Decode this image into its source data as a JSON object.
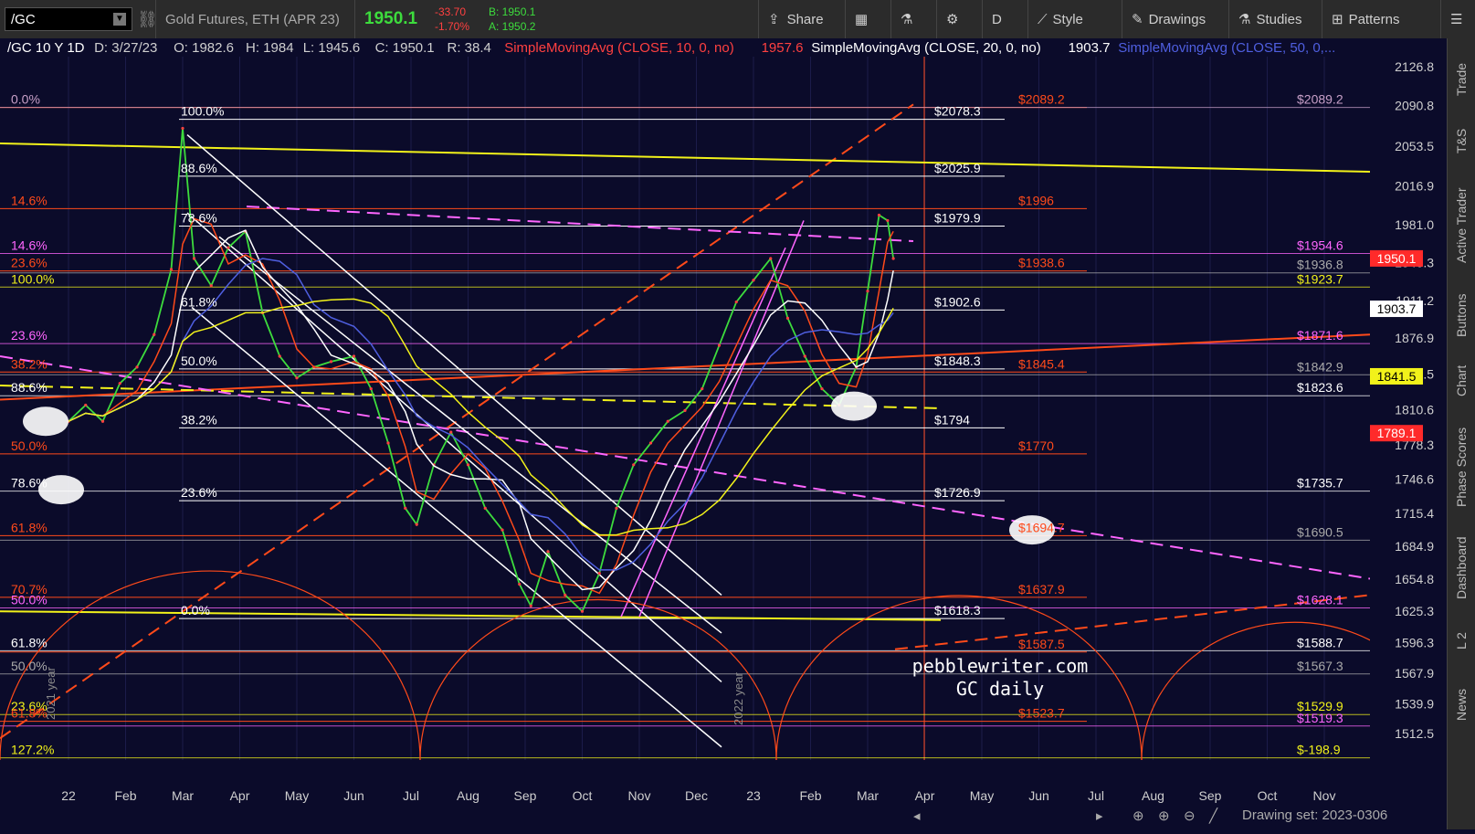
{
  "toolbar": {
    "symbol": "/GC",
    "description": "Gold Futures, ETH (APR 23)",
    "last": "1950.1",
    "change": "-33.70",
    "change_pct": "-1.70%",
    "bid": "B: 1950.1",
    "ask": "A: 1950.2",
    "share": "Share",
    "period": "D",
    "style": "Style",
    "drawings": "Drawings",
    "studies": "Studies",
    "patterns": "Patterns"
  },
  "header": {
    "symbol_period": "/GC 10 Y 1D",
    "date": "D: 3/27/23",
    "open": "O: 1982.6",
    "high": "H: 1984",
    "low": "L: 1945.6",
    "close": "C: 1950.1",
    "range": "R: 38.4",
    "sma10": "SimpleMovingAvg (CLOSE, 10, 0, no)",
    "sma10_val": "1957.6",
    "sma20": "SimpleMovingAvg (CLOSE, 20, 0, no)",
    "sma20_val": "1903.7",
    "sma50": "SimpleMovingAvg (CLOSE, 50, 0,..."
  },
  "right_tabs": [
    "Trade",
    "T&S",
    "Active Trader",
    "Buttons",
    "Chart",
    "Phase Scores",
    "Dashboard",
    "L 2",
    "News"
  ],
  "bottom": {
    "drawing_set": "Drawing set: 2023-0306"
  },
  "watermark": {
    "line1": "pebblewriter.com",
    "line2": "GC daily"
  },
  "colors": {
    "bg": "#0b0b2a",
    "orange": "#ff4a1a",
    "yellow": "#f2f21a",
    "pink": "#ff66ff",
    "white": "#ffffff",
    "blue": "#4f5fe0"
  },
  "chart_data": {
    "type": "line",
    "x_labels": [
      "22",
      "Feb",
      "Mar",
      "Apr",
      "May",
      "Jun",
      "Jul",
      "Aug",
      "Sep",
      "Oct",
      "Nov",
      "Dec",
      "23",
      "Feb",
      "Mar",
      "Apr",
      "May",
      "Jun",
      "Jul",
      "Aug",
      "Sep",
      "Oct",
      "Nov"
    ],
    "y_ticks": [
      2126.8,
      2090.8,
      2053.5,
      2016.9,
      1981,
      1946.3,
      1911.2,
      1876.9,
      1843.5,
      1810.6,
      1778.3,
      1746.6,
      1715.4,
      1684.9,
      1654.8,
      1625.3,
      1596.3,
      1567.9,
      1539.9,
      1512.5
    ],
    "ylim": [
      1488,
      2136
    ],
    "price_tags": [
      {
        "label": "1950.1",
        "value": 1950.1,
        "color": "#ff2a2a"
      },
      {
        "label": "1903.7",
        "value": 1903.7,
        "color": "#ffffff"
      },
      {
        "label": "1841.5",
        "value": 1841.5,
        "color": "#f2f21a"
      },
      {
        "label": "1789.1",
        "value": 1789.1,
        "color": "#ff2a2a"
      }
    ],
    "fib_left": [
      {
        "label": "100.0%",
        "value": 2078.3
      },
      {
        "label": "88.6%",
        "value": 2025.9
      },
      {
        "label": "78.6%",
        "value": 1979.9
      },
      {
        "label": "61.8%",
        "value": 1902.6
      },
      {
        "label": "50.0%",
        "value": 1848.3
      },
      {
        "label": "38.2%",
        "value": 1794
      },
      {
        "label": "23.6%",
        "value": 1726.9
      },
      {
        "label": "0.0%",
        "value": 1618.3
      }
    ],
    "fib_right_white": [
      {
        "label": "$2078.3",
        "value": 2078.3
      },
      {
        "label": "$2025.9",
        "value": 2025.9
      },
      {
        "label": "$1979.9",
        "value": 1979.9
      },
      {
        "label": "$1902.6",
        "value": 1902.6
      },
      {
        "label": "$1848.3",
        "value": 1848.3
      },
      {
        "label": "$1794",
        "value": 1794
      },
      {
        "label": "$1726.9",
        "value": 1726.9
      },
      {
        "label": "$1618.3",
        "value": 1618.3
      }
    ],
    "levels_orange": [
      {
        "label": "$2089.2",
        "value": 2089.2
      },
      {
        "label": "$1996",
        "value": 1996
      },
      {
        "label": "$1938.6",
        "value": 1938.6
      },
      {
        "label": "$1845.4",
        "value": 1845.4
      },
      {
        "label": "$1770",
        "value": 1770
      },
      {
        "label": "$1694.7",
        "value": 1694.7
      },
      {
        "label": "$1637.9",
        "value": 1637.9
      },
      {
        "label": "$1587.5",
        "value": 1587.5
      },
      {
        "label": "$1523.7",
        "value": 1523.7
      }
    ],
    "levels_far_right": [
      {
        "label": "$2089.2",
        "value": 2089.2,
        "color": "#c8a0c8"
      },
      {
        "label": "$1954.6",
        "value": 1954.6,
        "color": "#ff66ff"
      },
      {
        "label": "$1936.8",
        "value": 1936.8,
        "color": "#aaaaaa"
      },
      {
        "label": "$1923.7",
        "value": 1923.7,
        "color": "#f2f21a"
      },
      {
        "label": "$1871.6",
        "value": 1871.6,
        "color": "#ff66ff"
      },
      {
        "label": "$1842.9",
        "value": 1842.9,
        "color": "#aaaaaa"
      },
      {
        "label": "$1823.6",
        "value": 1823.6,
        "color": "#ffffff"
      },
      {
        "label": "$1735.7",
        "value": 1735.7,
        "color": "#ffffff"
      },
      {
        "label": "$1690.5",
        "value": 1690.5,
        "color": "#aaaaaa"
      },
      {
        "label": "$1628.1",
        "value": 1628.1,
        "color": "#ff66ff"
      },
      {
        "label": "$1588.7",
        "value": 1588.7,
        "color": "#ffffff"
      },
      {
        "label": "$1567.3",
        "value": 1567.3,
        "color": "#aaaaaa"
      },
      {
        "label": "$1529.9",
        "value": 1529.9,
        "color": "#f2f21a"
      },
      {
        "label": "$1519.3",
        "value": 1519.3,
        "color": "#ff66ff"
      },
      {
        "label": "$-198.9",
        "value": 1490,
        "color": "#f2f21a"
      }
    ],
    "left_pct_labels": [
      {
        "label": "0.0%",
        "value": 2089.2,
        "color": "#c8a0c8"
      },
      {
        "label": "14.6%",
        "value": 1996,
        "color": "#ff4a1a"
      },
      {
        "label": "14.6%",
        "value": 1954.6,
        "color": "#ff66ff"
      },
      {
        "label": "23.6%",
        "value": 1938.6,
        "color": "#ff4a1a"
      },
      {
        "label": "100.0%",
        "value": 1923.7,
        "color": "#f2f21a"
      },
      {
        "label": "23.6%",
        "value": 1871.6,
        "color": "#ff66ff"
      },
      {
        "label": "38.2%",
        "value": 1845.4,
        "color": "#ff4a1a"
      },
      {
        "label": "88.6%",
        "value": 1823.6,
        "color": "#ffffff"
      },
      {
        "label": "50.0%",
        "value": 1770,
        "color": "#ff4a1a"
      },
      {
        "label": "78.6%",
        "value": 1735.7,
        "color": "#ffffff"
      },
      {
        "label": "61.8%",
        "value": 1694.7,
        "color": "#ff4a1a"
      },
      {
        "label": "70.7%",
        "value": 1637.9,
        "color": "#ff4a1a"
      },
      {
        "label": "50.0%",
        "value": 1628.1,
        "color": "#ff66ff"
      },
      {
        "label": "61.8%",
        "value": 1588.7,
        "color": "#ffffff"
      },
      {
        "label": "50.0%",
        "value": 1567.3,
        "color": "#aaaaaa"
      },
      {
        "label": "23.6%",
        "value": 1529.9,
        "color": "#f2f21a"
      },
      {
        "label": "61.8%",
        "value": 1523.7,
        "color": "#ff4a1a"
      },
      {
        "label": "127.2%",
        "value": 1490,
        "color": "#f2f21a"
      }
    ],
    "annotations": [
      "2022 year",
      "2021 year"
    ],
    "price_series": [
      {
        "t": 0,
        "p": 1800
      },
      {
        "t": 0.3,
        "p": 1815
      },
      {
        "t": 0.6,
        "p": 1800
      },
      {
        "t": 0.9,
        "p": 1835
      },
      {
        "t": 1.2,
        "p": 1850
      },
      {
        "t": 1.5,
        "p": 1880
      },
      {
        "t": 1.8,
        "p": 1940
      },
      {
        "t": 2.0,
        "p": 2070
      },
      {
        "t": 2.2,
        "p": 1950
      },
      {
        "t": 2.5,
        "p": 1925
      },
      {
        "t": 2.8,
        "p": 1960
      },
      {
        "t": 3.1,
        "p": 1975
      },
      {
        "t": 3.4,
        "p": 1900
      },
      {
        "t": 3.7,
        "p": 1860
      },
      {
        "t": 4.0,
        "p": 1840
      },
      {
        "t": 4.3,
        "p": 1850
      },
      {
        "t": 4.6,
        "p": 1855
      },
      {
        "t": 5.0,
        "p": 1860
      },
      {
        "t": 5.3,
        "p": 1830
      },
      {
        "t": 5.6,
        "p": 1780
      },
      {
        "t": 5.9,
        "p": 1720
      },
      {
        "t": 6.1,
        "p": 1705
      },
      {
        "t": 6.4,
        "p": 1760
      },
      {
        "t": 6.7,
        "p": 1790
      },
      {
        "t": 7.0,
        "p": 1760
      },
      {
        "t": 7.3,
        "p": 1720
      },
      {
        "t": 7.6,
        "p": 1700
      },
      {
        "t": 7.9,
        "p": 1650
      },
      {
        "t": 8.1,
        "p": 1630
      },
      {
        "t": 8.4,
        "p": 1680
      },
      {
        "t": 8.7,
        "p": 1640
      },
      {
        "t": 9.0,
        "p": 1625
      },
      {
        "t": 9.3,
        "p": 1660
      },
      {
        "t": 9.6,
        "p": 1720
      },
      {
        "t": 9.9,
        "p": 1760
      },
      {
        "t": 10.2,
        "p": 1780
      },
      {
        "t": 10.5,
        "p": 1800
      },
      {
        "t": 10.8,
        "p": 1810
      },
      {
        "t": 11.1,
        "p": 1830
      },
      {
        "t": 11.4,
        "p": 1870
      },
      {
        "t": 11.7,
        "p": 1910
      },
      {
        "t": 12.0,
        "p": 1930
      },
      {
        "t": 12.3,
        "p": 1950
      },
      {
        "t": 12.6,
        "p": 1895
      },
      {
        "t": 12.9,
        "p": 1860
      },
      {
        "t": 13.2,
        "p": 1830
      },
      {
        "t": 13.5,
        "p": 1815
      },
      {
        "t": 13.8,
        "p": 1850
      },
      {
        "t": 14.0,
        "p": 1920
      },
      {
        "t": 14.2,
        "p": 1990
      },
      {
        "t": 14.35,
        "p": 1985
      },
      {
        "t": 14.45,
        "p": 1950
      }
    ]
  }
}
